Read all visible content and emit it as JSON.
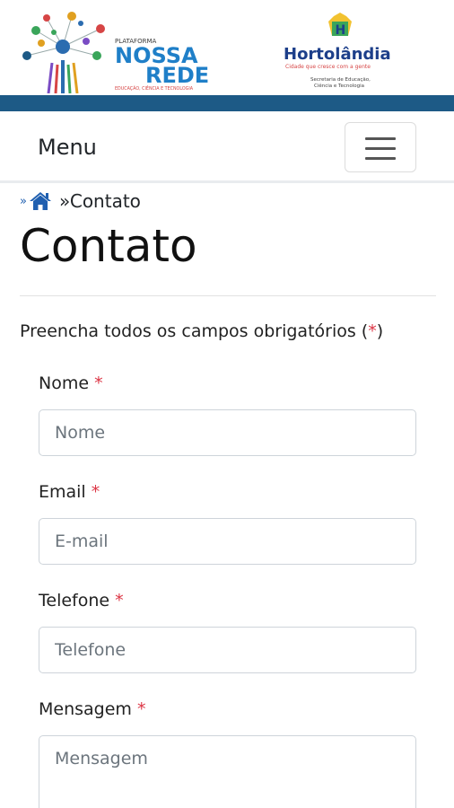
{
  "header": {
    "left_logo": {
      "small": "PLATAFORMA",
      "line1": "NOSSA",
      "line2": "REDE",
      "tagline": "EDUCAÇÃO, CIÊNCIA E TECNOLOGIA"
    },
    "right_logo": {
      "letter": "H",
      "name": "Hortolândia",
      "slogan": "Cidade que cresce com a gente",
      "dept_line1": "Secretaria de Educação,",
      "dept_line2": "Ciência e Tecnologia"
    },
    "band_color": "#1d5a86"
  },
  "navbar": {
    "menu_label": "Menu",
    "toggler_icon": "hamburger-icon"
  },
  "breadcrumb": {
    "sep": "»",
    "home_icon": "home-icon",
    "current": "»Contato"
  },
  "page": {
    "title": "Contato",
    "intro_prefix": "Preencha todos os campos obrigatórios (",
    "intro_star": "*",
    "intro_suffix": ")"
  },
  "form": {
    "required_mark": "*",
    "fields": [
      {
        "label": "Nome",
        "placeholder": "Nome",
        "value": ""
      },
      {
        "label": "Email",
        "placeholder": "E-mail",
        "value": ""
      },
      {
        "label": "Telefone",
        "placeholder": "Telefone",
        "value": ""
      },
      {
        "label": "Mensagem",
        "placeholder": "Mensagem",
        "value": ""
      }
    ]
  },
  "colors": {
    "brand_blue": "#1f5fb0",
    "required_red": "#dc3545"
  }
}
